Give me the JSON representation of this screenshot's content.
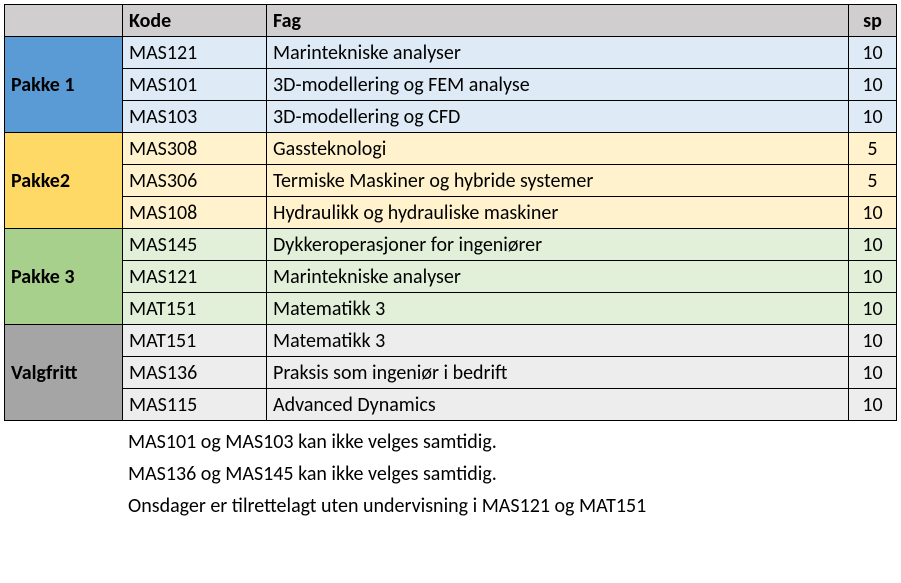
{
  "headers": {
    "kode": "Kode",
    "fag": "Fag",
    "sp": "sp"
  },
  "groups": [
    {
      "label": "Pakke 1",
      "labelClass": "bg-blue-label",
      "rowClass": "bg-blue-row",
      "rows": [
        {
          "kode": "MAS121",
          "fag": "Marintekniske analyser",
          "sp": "10"
        },
        {
          "kode": "MAS101",
          "fag": "3D-modellering og FEM analyse",
          "sp": "10"
        },
        {
          "kode": "MAS103",
          "fag": "3D-modellering og CFD",
          "sp": "10"
        }
      ]
    },
    {
      "label": "Pakke2",
      "labelClass": "bg-yellow-label",
      "rowClass": "bg-yellow-row",
      "rows": [
        {
          "kode": "MAS308",
          "fag": "Gassteknologi",
          "sp": "5"
        },
        {
          "kode": "MAS306",
          "fag": "Termiske Maskiner og hybride systemer",
          "sp": "5"
        },
        {
          "kode": "MAS108",
          "fag": "Hydraulikk og hydrauliske maskiner",
          "sp": "10"
        }
      ]
    },
    {
      "label": "Pakke 3",
      "labelClass": "bg-green-label",
      "rowClass": "bg-green-row",
      "rows": [
        {
          "kode": "MAS145",
          "fag": "Dykkeroperasjoner for ingeniører",
          "sp": "10"
        },
        {
          "kode": "MAS121",
          "fag": "Marintekniske analyser",
          "sp": "10"
        },
        {
          "kode": "MAT151",
          "fag": "Matematikk 3",
          "sp": "10"
        }
      ]
    },
    {
      "label": "Valgfritt",
      "labelClass": "bg-grey-label",
      "rowClass": "bg-grey-row",
      "rows": [
        {
          "kode": "MAT151",
          "fag": "Matematikk 3",
          "sp": "10"
        },
        {
          "kode": "MAS136",
          "fag": "Praksis som ingeniør i bedrift",
          "sp": "10"
        },
        {
          "kode": "MAS115",
          "fag": "Advanced Dynamics",
          "sp": "10"
        }
      ]
    }
  ],
  "notes": [
    "MAS101 og MAS103 kan ikke velges samtidig.",
    "MAS136 og MAS145 kan ikke velges samtidig.",
    "Onsdager er tilrettelagt uten undervisning i MAS121 og MAT151"
  ]
}
